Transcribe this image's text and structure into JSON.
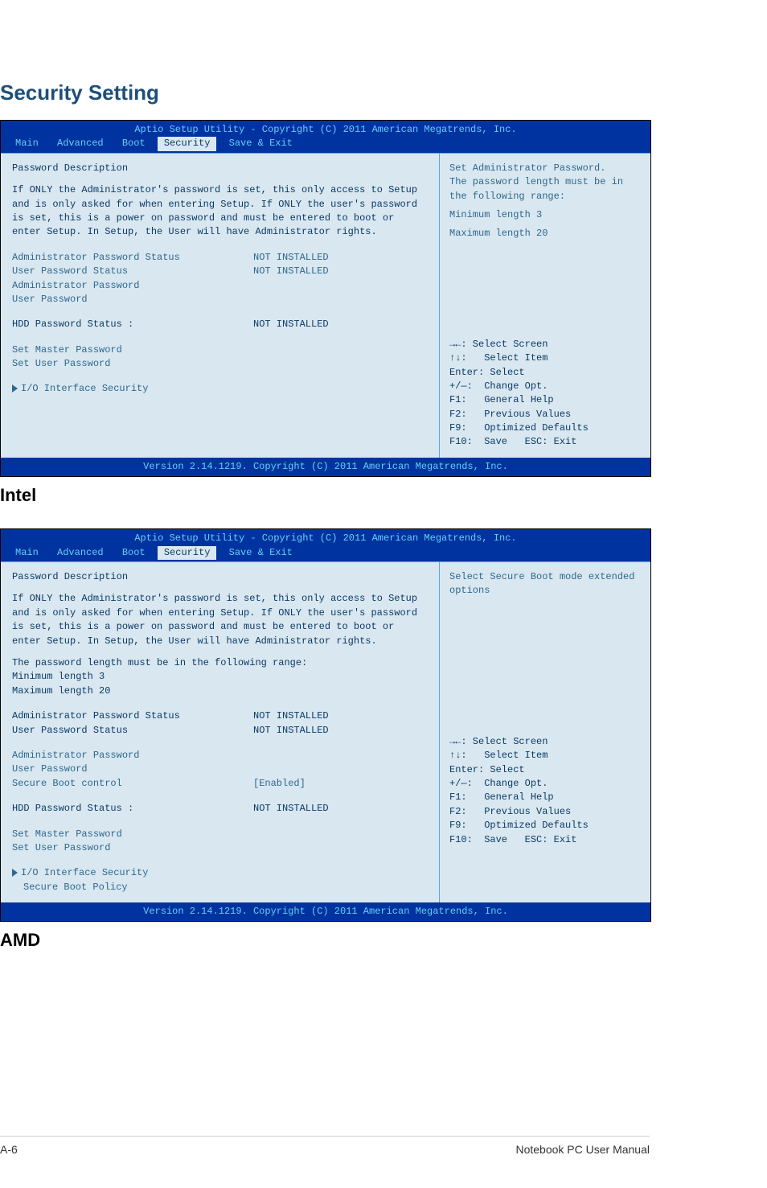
{
  "page": {
    "title": "Security Setting",
    "intel_label": "Intel",
    "amd_label": "AMD"
  },
  "shared": {
    "topbar": "Aptio Setup Utility - Copyright (C) 2011 American Megatrends, Inc.",
    "bottombar": "Version 2.14.1219. Copyright (C) 2011 American Megatrends, Inc.",
    "tabs": {
      "main": "Main",
      "advanced": "Advanced",
      "boot": "Boot",
      "security": "Security",
      "save": "Save & Exit"
    },
    "keys": {
      "l1": "→←: Select Screen",
      "l2": "↑↓:   Select Item",
      "l3": "Enter: Select",
      "l4": "+/—:  Change Opt.",
      "l5": "F1:   General Help",
      "l6": "F2:   Previous Values",
      "l7": "F9:   Optimized Defaults",
      "l8": "F10:  Save   ESC: Exit"
    }
  },
  "intel": {
    "left": {
      "heading": "Password Description",
      "para1": "If ONLY the Administrator's password is set, this only access to Setup and is only asked for when entering Setup. If ONLY the user's password is set, this is a power on password and must be entered to boot or enter Setup. In Setup, the User will have Administrator rights.",
      "admin_status_lbl": "Administrator Password Status",
      "admin_status_val": "NOT INSTALLED",
      "user_status_lbl": "User Password Status",
      "user_status_val": "NOT INSTALLED",
      "admin_pw": "Administrator Password",
      "user_pw": "User Password",
      "hdd_lbl": "HDD Password Status :",
      "hdd_val": "NOT INSTALLED",
      "set_master": "Set Master Password",
      "set_user": "Set User Password",
      "io_sec": "I/O Interface Security"
    },
    "right": {
      "l1": "Set Administrator Password.",
      "l2": "The password length must be in the following range:",
      "l3": "Minimum length  3",
      "l4": "Maximum length 20"
    }
  },
  "amd": {
    "left": {
      "heading": "Password Description",
      "para1": "If ONLY the Administrator's password is set, this only access to Setup and is only asked for when entering Setup. If ONLY the user's password is set, this is a power on password and must be entered to boot or enter Setup. In Setup, the User will have Administrator rights.",
      "para2": "The password length must be in the following range:",
      "min": "Minimum length   3",
      "max": "Maximum length  20",
      "admin_status_lbl": "Administrator Password Status",
      "admin_status_val": "NOT INSTALLED",
      "user_status_lbl": "User Password Status",
      "user_status_val": "NOT INSTALLED",
      "admin_pw": "Administrator Password",
      "user_pw": "User Password",
      "secure_boot_lbl": "Secure Boot control",
      "secure_boot_val": "[Enabled]",
      "hdd_lbl": "HDD Password Status :",
      "hdd_val": "NOT INSTALLED",
      "set_master": "Set Master Password",
      "set_user": "Set User Password",
      "io_sec": "I/O Interface Security",
      "secure_policy": "Secure Boot Policy"
    },
    "right": {
      "l1": "Select Secure Boot mode extended options"
    }
  },
  "footer": {
    "left": "A-6",
    "right": "Notebook PC User Manual"
  }
}
